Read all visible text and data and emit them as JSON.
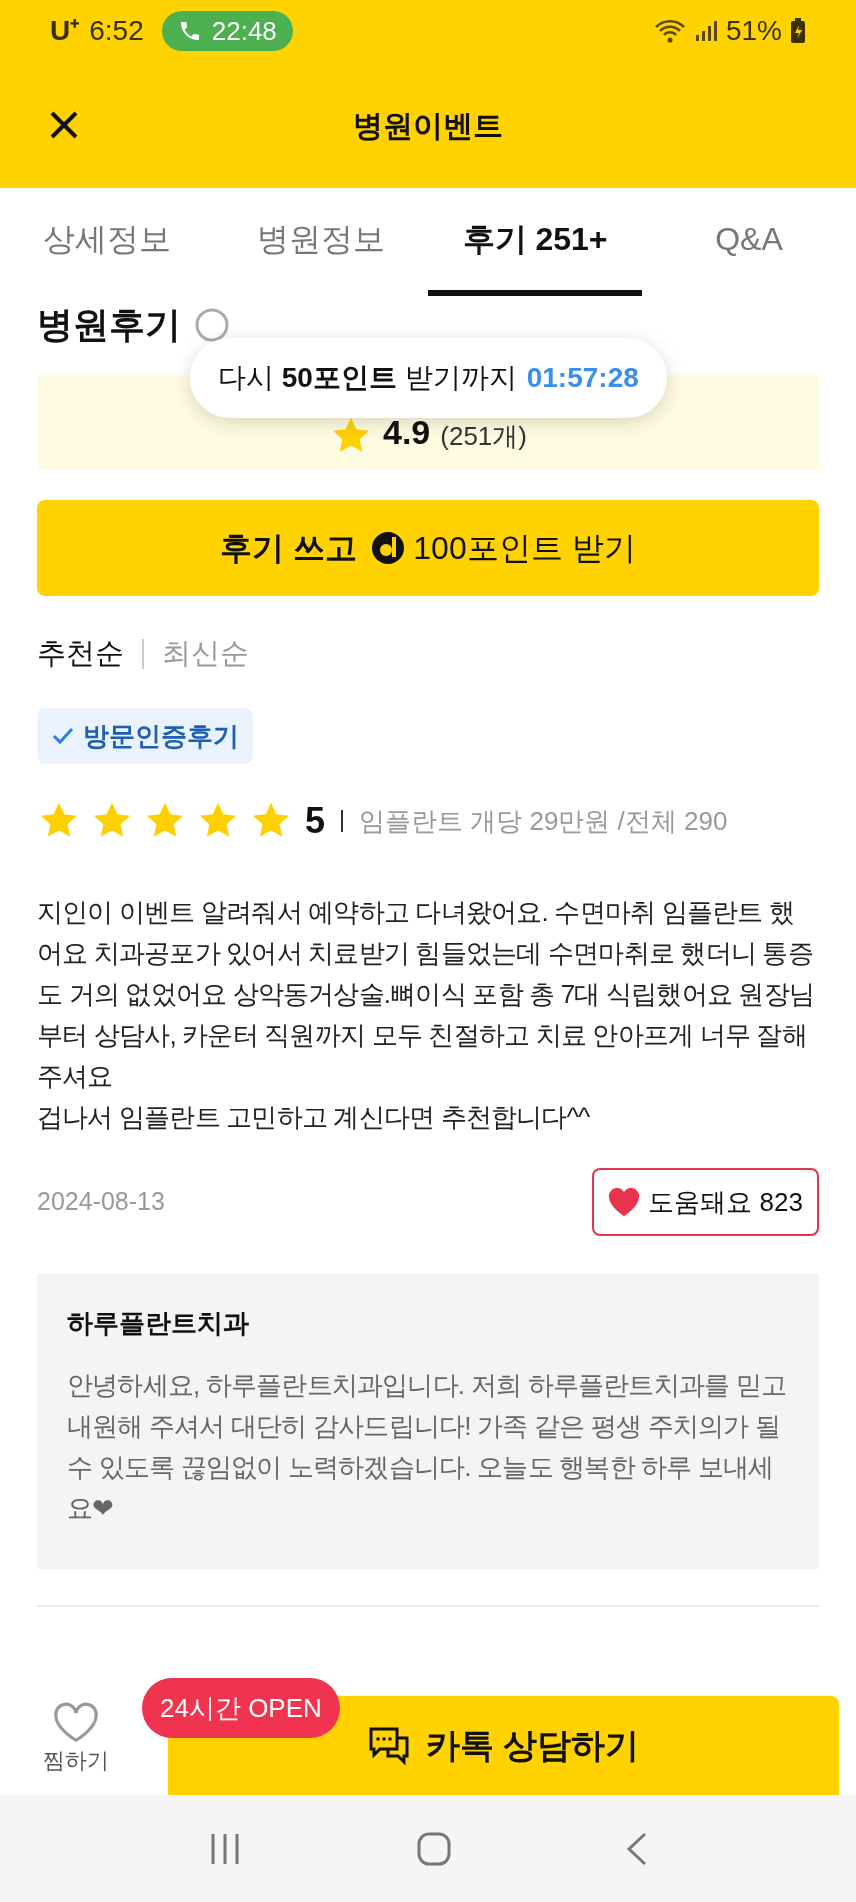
{
  "status_bar": {
    "carrier": "U⁺",
    "time": "6:52",
    "call_time": "22:48",
    "battery": "51%"
  },
  "header": {
    "title": "병원이벤트"
  },
  "tabs": [
    {
      "label": "상세정보",
      "selected": false
    },
    {
      "label": "병원정보",
      "selected": false
    },
    {
      "label": "후기 251+",
      "selected": true
    },
    {
      "label": "Q&A",
      "selected": false
    }
  ],
  "section_title": "병원후기",
  "tooltip": {
    "text": "다시 **50포인트** 받기까지",
    "timer": "01:57:28"
  },
  "rating": {
    "score": "4.9",
    "count": "(251개)"
  },
  "write_button": {
    "lead": "후기 쓰고",
    "points": "100포인트 받기"
  },
  "sort_options": [
    {
      "label": "추천순",
      "selected": true
    },
    {
      "label": "최신순",
      "selected": false
    }
  ],
  "review": {
    "badge": "방문인증후기",
    "stars": 5,
    "score": "5",
    "price": "임플란트 개당 29만원 /전체 290",
    "paragraphs": [
      "지인이 이벤트 알려줘서 예약하고 다녀왔어요. 수면마취 임플란트 했어요 치과공포가 있어서 치료받기 힘들었는데 수면마취로 했더니 통증도 거의 없었어요 상악동거상술.뼈이식 포함 총 7대 식립했어요 원장님부터 상담사, 카운터 직원까지 모두 친절하고 치료 안아프게 너무 잘해주셔요",
      "겁나서 임플란트 고민하고 계신다면 추천합니다^^"
    ],
    "date": "2024-08-13",
    "helpful": {
      "label": "도움돼요 823",
      "liked": true
    },
    "reply": {
      "name": "하루플란트치과",
      "text": "안녕하세요, 하루플란트치과입니다. 저희 하루플란트치과를 믿고 내원해 주셔서 대단히 감사드립니다! 가족 같은 평생 주치의가 될 수 있도록 끊임없이 노력하겠습니다. 오늘도 행복한 하루 보내세요❤"
    }
  },
  "bottom_bar": {
    "favorite_label": "찜하기",
    "favorited": false,
    "open_badge": "24시간 OPEN",
    "cta": "카톡 상담하기"
  }
}
